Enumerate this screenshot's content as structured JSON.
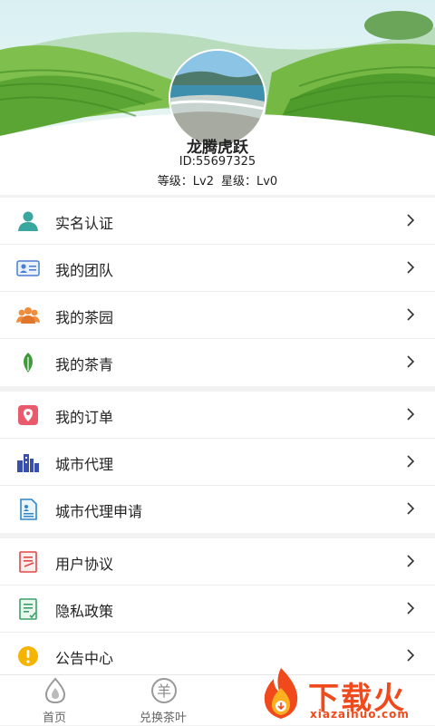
{
  "profile": {
    "username": "龙腾虎跃",
    "id_text": "ID:55697325",
    "grade": "等级：Lv2",
    "star": "星级：Lv0"
  },
  "menu_groups": [
    [
      {
        "label": "实名认证",
        "icon": "person-icon"
      },
      {
        "label": "我的团队",
        "icon": "id-card-icon"
      },
      {
        "label": "我的茶园",
        "icon": "group-icon"
      },
      {
        "label": "我的茶青",
        "icon": "leaf-icon"
      }
    ],
    [
      {
        "label": "我的订单",
        "icon": "location-pin-icon"
      },
      {
        "label": "城市代理",
        "icon": "city-buildings-icon"
      },
      {
        "label": "城市代理申请",
        "icon": "document-icon"
      }
    ],
    [
      {
        "label": "用户协议",
        "icon": "agreement-icon"
      },
      {
        "label": "隐私政策",
        "icon": "policy-icon"
      },
      {
        "label": "公告中心",
        "icon": "notice-icon"
      }
    ]
  ],
  "tabbar": {
    "home": "首页",
    "exchange": "兑换茶叶",
    "exchange_symbol": "羊"
  },
  "watermark": {
    "title": "下载火",
    "subtitle": "xiazaihuo.com"
  },
  "colors": {
    "accent_green": "#3f9b3a",
    "watermark_orange": "#f04a1c"
  }
}
